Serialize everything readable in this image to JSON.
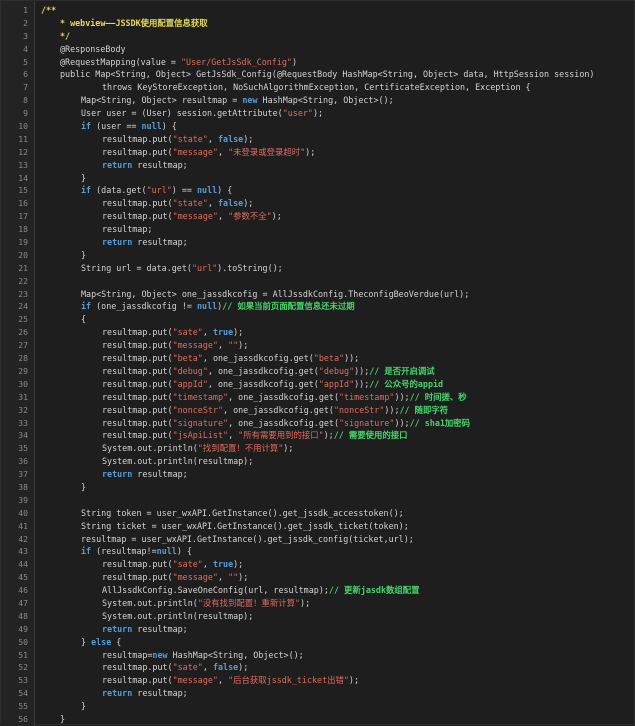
{
  "lines": [
    {
      "n": "1",
      "indent": 0,
      "tokens": [
        {
          "t": "/**",
          "c": "c"
        }
      ]
    },
    {
      "n": "2",
      "indent": 1,
      "tokens": [
        {
          "t": "* webview——JSSDK使用配置信息获取",
          "c": "c"
        }
      ]
    },
    {
      "n": "3",
      "indent": 1,
      "tokens": [
        {
          "t": "*/",
          "c": "c"
        }
      ]
    },
    {
      "n": "4",
      "indent": 1,
      "tokens": [
        {
          "t": "@ResponseBody",
          "c": "p"
        }
      ]
    },
    {
      "n": "5",
      "indent": 1,
      "tokens": [
        {
          "t": "@RequestMapping(value = ",
          "c": "p"
        },
        {
          "t": "\"User/GetJsSdk_Config\"",
          "c": "s"
        },
        {
          "t": ")",
          "c": "p"
        }
      ]
    },
    {
      "n": "6",
      "indent": 1,
      "tokens": [
        {
          "t": "public Map<String, Object> GetJsSdk_Config(@RequestBody HashMap<String, Object> data, HttpSession session)",
          "c": "p"
        }
      ]
    },
    {
      "n": "7",
      "indent": 3,
      "tokens": [
        {
          "t": "throws KeyStoreException, NoSuchAlgorithmException, CertificateException, Exception {",
          "c": "p"
        }
      ]
    },
    {
      "n": "8",
      "indent": 2,
      "tokens": [
        {
          "t": "Map<String, Object> resultmap = ",
          "c": "p"
        },
        {
          "t": "new",
          "c": "k"
        },
        {
          "t": " HashMap<String, Object>();",
          "c": "p"
        }
      ]
    },
    {
      "n": "9",
      "indent": 2,
      "tokens": [
        {
          "t": "User user = (User) session.getAttribute(",
          "c": "p"
        },
        {
          "t": "\"user\"",
          "c": "s"
        },
        {
          "t": ");",
          "c": "p"
        }
      ]
    },
    {
      "n": "10",
      "indent": 2,
      "tokens": [
        {
          "t": "if",
          "c": "k"
        },
        {
          "t": " (user == ",
          "c": "p"
        },
        {
          "t": "null",
          "c": "k"
        },
        {
          "t": ") {",
          "c": "p"
        }
      ]
    },
    {
      "n": "11",
      "indent": 3,
      "tokens": [
        {
          "t": "resultmap.put(",
          "c": "p"
        },
        {
          "t": "\"state\"",
          "c": "s"
        },
        {
          "t": ", ",
          "c": "p"
        },
        {
          "t": "false",
          "c": "k"
        },
        {
          "t": ");",
          "c": "p"
        }
      ]
    },
    {
      "n": "12",
      "indent": 3,
      "tokens": [
        {
          "t": "resultmap.put(",
          "c": "p"
        },
        {
          "t": "\"message\"",
          "c": "s"
        },
        {
          "t": ", ",
          "c": "p"
        },
        {
          "t": "\"未登录或登录超时\"",
          "c": "s"
        },
        {
          "t": ");",
          "c": "p"
        }
      ]
    },
    {
      "n": "13",
      "indent": 3,
      "tokens": [
        {
          "t": "return",
          "c": "k"
        },
        {
          "t": " resultmap;",
          "c": "p"
        }
      ]
    },
    {
      "n": "14",
      "indent": 2,
      "tokens": [
        {
          "t": "}",
          "c": "p"
        }
      ]
    },
    {
      "n": "15",
      "indent": 2,
      "tokens": [
        {
          "t": "if",
          "c": "k"
        },
        {
          "t": " (data.get(",
          "c": "p"
        },
        {
          "t": "\"url\"",
          "c": "s"
        },
        {
          "t": ") == ",
          "c": "p"
        },
        {
          "t": "null",
          "c": "k"
        },
        {
          "t": ") {",
          "c": "p"
        }
      ]
    },
    {
      "n": "16",
      "indent": 3,
      "tokens": [
        {
          "t": "resultmap.put(",
          "c": "p"
        },
        {
          "t": "\"state\"",
          "c": "s"
        },
        {
          "t": ", ",
          "c": "p"
        },
        {
          "t": "false",
          "c": "k"
        },
        {
          "t": ");",
          "c": "p"
        }
      ]
    },
    {
      "n": "17",
      "indent": 3,
      "tokens": [
        {
          "t": "resultmap.put(",
          "c": "p"
        },
        {
          "t": "\"message\"",
          "c": "s"
        },
        {
          "t": ", ",
          "c": "p"
        },
        {
          "t": "\"参数不全\"",
          "c": "s"
        },
        {
          "t": ");",
          "c": "p"
        }
      ]
    },
    {
      "n": "18",
      "indent": 3,
      "tokens": [
        {
          "t": "resultmap;",
          "c": "p"
        }
      ]
    },
    {
      "n": "19",
      "indent": 3,
      "tokens": [
        {
          "t": "return",
          "c": "k"
        },
        {
          "t": " resultmap;",
          "c": "p"
        }
      ]
    },
    {
      "n": "20",
      "indent": 2,
      "tokens": [
        {
          "t": "}",
          "c": "p"
        }
      ]
    },
    {
      "n": "21",
      "indent": 2,
      "tokens": [
        {
          "t": "String url = data.get(",
          "c": "p"
        },
        {
          "t": "\"url\"",
          "c": "s"
        },
        {
          "t": ").toString();",
          "c": "p"
        }
      ]
    },
    {
      "n": "22",
      "indent": 0,
      "tokens": []
    },
    {
      "n": "23",
      "indent": 2,
      "tokens": [
        {
          "t": "Map<String, Object> one_jassdkcofig = AllJssdkConfig.TheconfigBeoVerdue(url);",
          "c": "p"
        }
      ]
    },
    {
      "n": "24",
      "indent": 2,
      "tokens": [
        {
          "t": "if",
          "c": "k"
        },
        {
          "t": " (one_jassdkcofig != ",
          "c": "p"
        },
        {
          "t": "null",
          "c": "k"
        },
        {
          "t": ")",
          "c": "p"
        },
        {
          "t": "// 如果当前页面配置信息还未过期",
          "c": "g"
        }
      ]
    },
    {
      "n": "25",
      "indent": 2,
      "tokens": [
        {
          "t": "{",
          "c": "p"
        }
      ]
    },
    {
      "n": "26",
      "indent": 3,
      "tokens": [
        {
          "t": "resultmap.put(",
          "c": "p"
        },
        {
          "t": "\"sate\"",
          "c": "s"
        },
        {
          "t": ", ",
          "c": "p"
        },
        {
          "t": "true",
          "c": "k"
        },
        {
          "t": ");",
          "c": "p"
        }
      ]
    },
    {
      "n": "27",
      "indent": 3,
      "tokens": [
        {
          "t": "resultmap.put(",
          "c": "p"
        },
        {
          "t": "\"message\"",
          "c": "s"
        },
        {
          "t": ", ",
          "c": "p"
        },
        {
          "t": "\"\"",
          "c": "s"
        },
        {
          "t": ");",
          "c": "p"
        }
      ]
    },
    {
      "n": "28",
      "indent": 3,
      "tokens": [
        {
          "t": "resultmap.put(",
          "c": "p"
        },
        {
          "t": "\"beta\"",
          "c": "s"
        },
        {
          "t": ", one_jassdkcofig.get(",
          "c": "p"
        },
        {
          "t": "\"beta\"",
          "c": "s"
        },
        {
          "t": "));",
          "c": "p"
        }
      ]
    },
    {
      "n": "29",
      "indent": 3,
      "tokens": [
        {
          "t": "resultmap.put(",
          "c": "p"
        },
        {
          "t": "\"debug\"",
          "c": "s"
        },
        {
          "t": ", one_jassdkcofig.get(",
          "c": "p"
        },
        {
          "t": "\"debug\"",
          "c": "s"
        },
        {
          "t": "));",
          "c": "p"
        },
        {
          "t": "// 是否开启调试",
          "c": "g"
        }
      ]
    },
    {
      "n": "30",
      "indent": 3,
      "tokens": [
        {
          "t": "resultmap.put(",
          "c": "p"
        },
        {
          "t": "\"appId\"",
          "c": "s"
        },
        {
          "t": ", one_jassdkcofig.get(",
          "c": "p"
        },
        {
          "t": "\"appId\"",
          "c": "s"
        },
        {
          "t": "));",
          "c": "p"
        },
        {
          "t": "// 公众号的appid",
          "c": "g"
        }
      ]
    },
    {
      "n": "31",
      "indent": 3,
      "tokens": [
        {
          "t": "resultmap.put(",
          "c": "p"
        },
        {
          "t": "\"timestamp\"",
          "c": "s"
        },
        {
          "t": ", one_jassdkcofig.get(",
          "c": "p"
        },
        {
          "t": "\"timestamp\"",
          "c": "s"
        },
        {
          "t": "));",
          "c": "p"
        },
        {
          "t": "// 时间搓、秒",
          "c": "g"
        }
      ]
    },
    {
      "n": "32",
      "indent": 3,
      "tokens": [
        {
          "t": "resultmap.put(",
          "c": "p"
        },
        {
          "t": "\"nonceStr\"",
          "c": "s"
        },
        {
          "t": ", one_jassdkcofig.get(",
          "c": "p"
        },
        {
          "t": "\"nonceStr\"",
          "c": "s"
        },
        {
          "t": "));",
          "c": "p"
        },
        {
          "t": "// 随即字符",
          "c": "g"
        }
      ]
    },
    {
      "n": "33",
      "indent": 3,
      "tokens": [
        {
          "t": "resultmap.put(",
          "c": "p"
        },
        {
          "t": "\"signature\"",
          "c": "s"
        },
        {
          "t": ", one_jassdkcofig.get(",
          "c": "p"
        },
        {
          "t": "\"signature\"",
          "c": "s"
        },
        {
          "t": "));",
          "c": "p"
        },
        {
          "t": "// sha1加密码",
          "c": "g"
        }
      ]
    },
    {
      "n": "34",
      "indent": 3,
      "tokens": [
        {
          "t": "resultmap.put(",
          "c": "p"
        },
        {
          "t": "\"jsApiList\"",
          "c": "s"
        },
        {
          "t": ", ",
          "c": "p"
        },
        {
          "t": "\"所有需要用到的接口\"",
          "c": "s"
        },
        {
          "t": ");",
          "c": "p"
        },
        {
          "t": "// 需要使用的接口",
          "c": "g"
        }
      ]
    },
    {
      "n": "35",
      "indent": 3,
      "tokens": [
        {
          "t": "System.out.println(",
          "c": "p"
        },
        {
          "t": "\"找到配置！不用计算\"",
          "c": "s"
        },
        {
          "t": ");",
          "c": "p"
        }
      ]
    },
    {
      "n": "36",
      "indent": 3,
      "tokens": [
        {
          "t": "System.out.println(resultmap);",
          "c": "p"
        }
      ]
    },
    {
      "n": "37",
      "indent": 3,
      "tokens": [
        {
          "t": "return",
          "c": "k"
        },
        {
          "t": " resultmap;",
          "c": "p"
        }
      ]
    },
    {
      "n": "38",
      "indent": 2,
      "tokens": [
        {
          "t": "}",
          "c": "p"
        }
      ]
    },
    {
      "n": "39",
      "indent": 0,
      "tokens": []
    },
    {
      "n": "40",
      "indent": 2,
      "tokens": [
        {
          "t": "String token = user_wxAPI.GetInstance().get_jssdk_accesstoken();",
          "c": "p"
        }
      ]
    },
    {
      "n": "41",
      "indent": 2,
      "tokens": [
        {
          "t": "String ticket = user_wxAPI.GetInstance().get_jssdk_ticket(token);",
          "c": "p"
        }
      ]
    },
    {
      "n": "42",
      "indent": 2,
      "tokens": [
        {
          "t": "resultmap = user_wxAPI.GetInstance().get_jssdk_config(ticket,url);",
          "c": "p"
        }
      ]
    },
    {
      "n": "43",
      "indent": 2,
      "tokens": [
        {
          "t": "if",
          "c": "k"
        },
        {
          "t": " (resultmap!=",
          "c": "p"
        },
        {
          "t": "null",
          "c": "k"
        },
        {
          "t": ") {",
          "c": "p"
        }
      ]
    },
    {
      "n": "44",
      "indent": 3,
      "tokens": [
        {
          "t": "resultmap.put(",
          "c": "p"
        },
        {
          "t": "\"sate\"",
          "c": "s"
        },
        {
          "t": ", ",
          "c": "p"
        },
        {
          "t": "true",
          "c": "k"
        },
        {
          "t": ");",
          "c": "p"
        }
      ]
    },
    {
      "n": "45",
      "indent": 3,
      "tokens": [
        {
          "t": "resultmap.put(",
          "c": "p"
        },
        {
          "t": "\"message\"",
          "c": "s"
        },
        {
          "t": ", ",
          "c": "p"
        },
        {
          "t": "\"\"",
          "c": "s"
        },
        {
          "t": ");",
          "c": "p"
        }
      ]
    },
    {
      "n": "46",
      "indent": 3,
      "tokens": [
        {
          "t": "AllJssdkConfig.SaveOneConfig(url, resultmap);",
          "c": "p"
        },
        {
          "t": "// 更新jasdk数组配置",
          "c": "g"
        }
      ]
    },
    {
      "n": "47",
      "indent": 3,
      "tokens": [
        {
          "t": "System.out.println(",
          "c": "p"
        },
        {
          "t": "\"没有找到配置！重新计算\"",
          "c": "s"
        },
        {
          "t": ");",
          "c": "p"
        }
      ]
    },
    {
      "n": "48",
      "indent": 3,
      "tokens": [
        {
          "t": "System.out.println(resultmap);",
          "c": "p"
        }
      ]
    },
    {
      "n": "49",
      "indent": 3,
      "tokens": [
        {
          "t": "return",
          "c": "k"
        },
        {
          "t": " resultmap;",
          "c": "p"
        }
      ]
    },
    {
      "n": "50",
      "indent": 2,
      "tokens": [
        {
          "t": "} ",
          "c": "p"
        },
        {
          "t": "else",
          "c": "k"
        },
        {
          "t": " {",
          "c": "p"
        }
      ]
    },
    {
      "n": "51",
      "indent": 3,
      "tokens": [
        {
          "t": "resultmap=",
          "c": "p"
        },
        {
          "t": "new",
          "c": "k"
        },
        {
          "t": " HashMap<String, Object>();",
          "c": "p"
        }
      ]
    },
    {
      "n": "52",
      "indent": 3,
      "tokens": [
        {
          "t": "resultmap.put(",
          "c": "p"
        },
        {
          "t": "\"sate\"",
          "c": "s"
        },
        {
          "t": ", ",
          "c": "p"
        },
        {
          "t": "false",
          "c": "k"
        },
        {
          "t": ");",
          "c": "p"
        }
      ]
    },
    {
      "n": "53",
      "indent": 3,
      "tokens": [
        {
          "t": "resultmap.put(",
          "c": "p"
        },
        {
          "t": "\"message\"",
          "c": "s"
        },
        {
          "t": ", ",
          "c": "p"
        },
        {
          "t": "\"后台获取jssdk_ticket出错\"",
          "c": "s"
        },
        {
          "t": ");",
          "c": "p"
        }
      ]
    },
    {
      "n": "54",
      "indent": 3,
      "tokens": [
        {
          "t": "return",
          "c": "k"
        },
        {
          "t": " resultmap;",
          "c": "p"
        }
      ]
    },
    {
      "n": "55",
      "indent": 2,
      "tokens": [
        {
          "t": "}",
          "c": "p"
        }
      ]
    },
    {
      "n": "56",
      "indent": 1,
      "tokens": [
        {
          "t": "}",
          "c": "p"
        }
      ]
    }
  ]
}
